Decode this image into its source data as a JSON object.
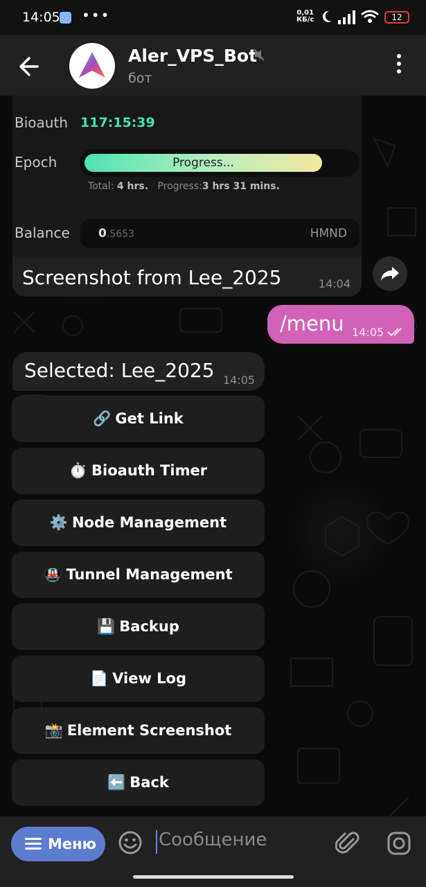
{
  "status_bar": {
    "time": "14:05",
    "net_speed_value": "0,01",
    "net_speed_unit": "КБ/с",
    "battery": "12"
  },
  "header": {
    "title": "Aler_VPS_Bot",
    "subtitle": "бот"
  },
  "screenshot_message": {
    "bioauth_label": "Bioauth",
    "bioauth_value": "117:15:39",
    "epoch_label": "Epoch",
    "epoch_progress_text": "Progress...",
    "epoch_progress_fraction": 0.88,
    "total_label": "Total:",
    "total_value": "4 hrs.",
    "progress_label": "Progress:",
    "progress_value": "3 hrs 31 mins.",
    "balance_label": "Balance",
    "balance_value_main": "0",
    "balance_value_decimal": ".5653",
    "balance_unit": "HMND",
    "caption": "Screenshot from Lee_2025",
    "time": "14:04"
  },
  "outgoing_message": {
    "text": "/menu",
    "time": "14:05"
  },
  "incoming_message": {
    "text": "Selected: Lee_2025",
    "time": "14:05"
  },
  "inline_keyboard": [
    {
      "icon": "🔗",
      "label": "Get Link"
    },
    {
      "icon": "⏱️",
      "label": "Bioauth Timer"
    },
    {
      "icon": "⚙️",
      "label": "Node Management"
    },
    {
      "icon": "🚇",
      "label": "Tunnel Management"
    },
    {
      "icon": "💾",
      "label": "Backup"
    },
    {
      "icon": "📄",
      "label": "View Log"
    },
    {
      "icon": "📸",
      "label": "Element Screenshot"
    },
    {
      "icon": "⬅️",
      "label": "Back"
    }
  ],
  "input_bar": {
    "menu_label": "Меню",
    "placeholder": "Сообщение"
  },
  "colors": {
    "outgoing_bubble": "#d063b8",
    "menu_button": "#5b7ccf",
    "bioauth_value": "#46e3a8"
  }
}
